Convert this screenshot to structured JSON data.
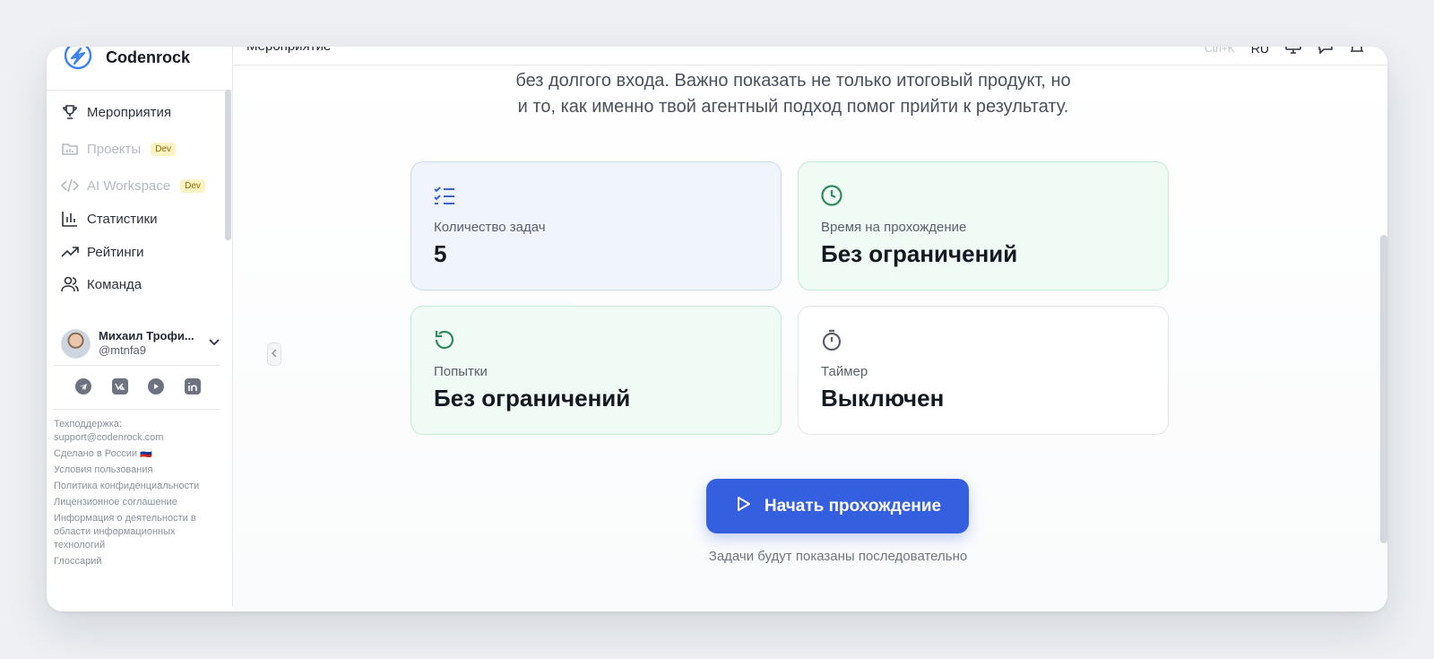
{
  "brand": {
    "name": "Codenrock"
  },
  "sidebar": {
    "items": [
      {
        "label": "Мероприятия",
        "icon": "trophy-icon",
        "badge": ""
      },
      {
        "label": "Проекты",
        "icon": "folder-icon",
        "badge": "Dev"
      },
      {
        "label": "AI Workspace",
        "icon": "code-icon",
        "badge": "Dev"
      },
      {
        "label": "Статистики",
        "icon": "bar-chart-icon",
        "badge": ""
      },
      {
        "label": "Рейтинги",
        "icon": "trending-up-icon",
        "badge": ""
      },
      {
        "label": "Команда",
        "icon": "users-icon",
        "badge": ""
      }
    ],
    "user": {
      "name": "Михаил Трофи...",
      "handle": "@mtnfa9"
    },
    "footer": {
      "support_label": "Техподдержка:",
      "support_email": "support@codenrock.com",
      "made_in": "Сделано в России 🇷🇺",
      "terms": "Условия пользования",
      "privacy": "Политика конфиденциальности",
      "license": "Лицензионное соглашение",
      "info": "Информация о деятельности в области информационных технологий",
      "glossary": "Глоссарий"
    }
  },
  "topbar": {
    "title": "Мероприятие",
    "hotkey": "Ctrl+K",
    "language": "RU"
  },
  "description": {
    "line1": "без долгого входа. Важно показать не только итоговый продукт, но",
    "line2": "и то, как именно твой агентный подход помог прийти к результату."
  },
  "cards": [
    {
      "label": "Количество задач",
      "value": "5",
      "icon": "checklist-icon",
      "accent": "#3a63d6"
    },
    {
      "label": "Время на прохождение",
      "value": "Без ограничений",
      "icon": "clock-icon",
      "accent": "#2f8a5c"
    },
    {
      "label": "Попытки",
      "value": "Без ограничений",
      "icon": "retry-icon",
      "accent": "#2f8a5c"
    },
    {
      "label": "Таймер",
      "value": "Выключен",
      "icon": "stopwatch-icon",
      "accent": "#5a606b"
    }
  ],
  "start": {
    "label": "Начать прохождение",
    "hint": "Задачи будут показаны последовательно"
  },
  "colors": {
    "primary": "#3460e0",
    "blue_card": "#eff4fd",
    "green_card": "#effbf4"
  }
}
